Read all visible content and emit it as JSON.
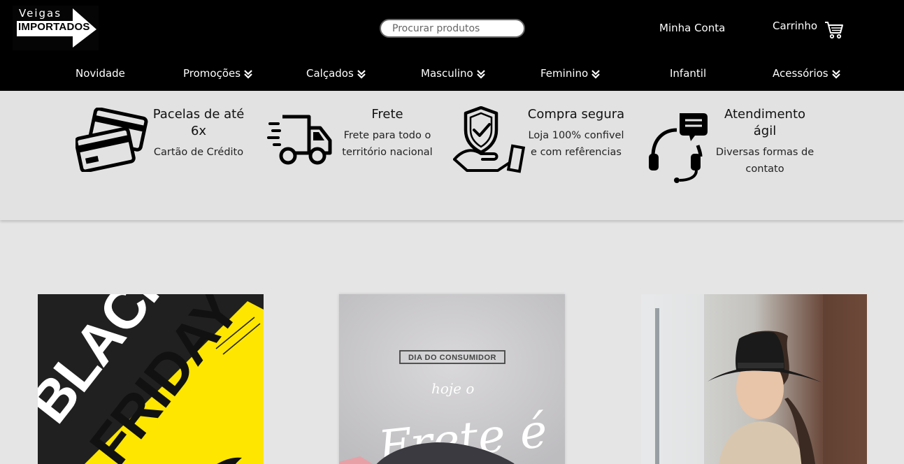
{
  "header": {
    "logo": {
      "top_text": "Veigas",
      "bottom_text": "IMPORTADOS"
    },
    "search": {
      "placeholder": "Procurar produtos"
    },
    "account_label": "Minha Conta",
    "cart_label": "Carrinho"
  },
  "nav": {
    "items": [
      {
        "label": "Novidade",
        "has_dropdown": false
      },
      {
        "label": "Promoções",
        "has_dropdown": true
      },
      {
        "label": "Calçados",
        "has_dropdown": true
      },
      {
        "label": "Masculino",
        "has_dropdown": true
      },
      {
        "label": "Feminino",
        "has_dropdown": true
      },
      {
        "label": "Infantil",
        "has_dropdown": false
      },
      {
        "label": "Acessórios",
        "has_dropdown": true
      }
    ]
  },
  "features": [
    {
      "icon": "credit-cards-icon",
      "title_line1": "Pacelas de até",
      "title_line2": "6x",
      "sub_line1": "Cartão de Crédito",
      "sub_line2": ""
    },
    {
      "icon": "delivery-truck-icon",
      "title_line1": "Frete",
      "title_line2": "",
      "sub_line1": "Frete para todo o",
      "sub_line2": "território nacional"
    },
    {
      "icon": "secure-hand-shield-icon",
      "title_line1": "Compra segura",
      "title_line2": "",
      "sub_line1": "Loja 100% confivel",
      "sub_line2": "e com refêrencias"
    },
    {
      "icon": "headset-support-icon",
      "title_line1": "Atendimento",
      "title_line2": "ágil",
      "sub_line1": "Diversas formas de",
      "sub_line2": "contato"
    }
  ],
  "banners": [
    {
      "line1": "BLACK",
      "line2": "FRIDAY"
    },
    {
      "tag": "DIA DO CONSUMIDOR",
      "script1": "hoje o",
      "script2": "Frete é"
    },
    {}
  ],
  "colors": {
    "header_bg": "#000000",
    "band_bg": "#e2e2e2",
    "page_bg": "#e5e5e5",
    "black_friday_yellow": "#ffe600"
  }
}
